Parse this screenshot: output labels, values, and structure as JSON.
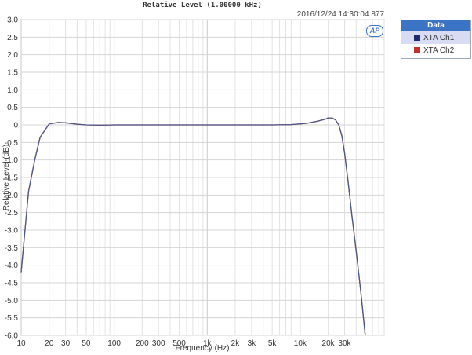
{
  "chart_data": {
    "type": "line",
    "title": "Relative Level (1.00000 kHz)",
    "timestamp": "2016/12/24 14:30:04.877",
    "xlabel": "Frequency (Hz)",
    "ylabel": "Relative Level (dB)",
    "x_scale": "log",
    "xlim": [
      10,
      80000
    ],
    "ylim": [
      -6.0,
      3.0
    ],
    "grid": true,
    "legend_position": "right",
    "x_tick_labels": [
      "10",
      "20",
      "30",
      "50",
      "100",
      "200",
      "300",
      "500",
      "1k",
      "2k",
      "3k",
      "5k",
      "10k",
      "20k",
      "30k"
    ],
    "x_tick_values": [
      10,
      20,
      30,
      50,
      100,
      200,
      300,
      500,
      1000,
      2000,
      3000,
      5000,
      10000,
      20000,
      30000
    ],
    "y_ticks": [
      3.0,
      2.5,
      2.0,
      1.5,
      1.0,
      0.5,
      0,
      -0.5,
      -1.0,
      -1.5,
      -2.0,
      -2.5,
      -3.0,
      -3.5,
      -4.0,
      -4.5,
      -5.0,
      -5.5,
      -6.0
    ],
    "y_tick_labels": [
      "3.0",
      "2.5",
      "2.0",
      "1.5",
      "1.0",
      "0.5",
      "0",
      "-0.5",
      "-1.0",
      "-1.5",
      "-2.0",
      "-2.5",
      "-3.0",
      "-3.5",
      "-4.0",
      "-4.5",
      "-5.0",
      "-5.5",
      "-6.0"
    ],
    "legend_title": "Data",
    "series": [
      {
        "name": "XTA Ch1",
        "color": "#1f2a6e",
        "x": [
          10,
          11,
          12,
          14,
          16,
          18,
          20,
          25,
          30,
          40,
          50,
          70,
          100,
          200,
          500,
          1000,
          2000,
          5000,
          8000,
          10000,
          12000,
          15000,
          18000,
          20000,
          22000,
          24000,
          26000,
          28000,
          30000,
          33000,
          36000,
          40000,
          45000,
          50000
        ],
        "values": [
          -4.2,
          -3.0,
          -1.9,
          -1.0,
          -0.35,
          -0.15,
          0.03,
          0.07,
          0.06,
          0.02,
          0.0,
          -0.01,
          0.0,
          0.0,
          0.0,
          0.0,
          0.0,
          0.0,
          0.01,
          0.03,
          0.05,
          0.1,
          0.15,
          0.2,
          0.2,
          0.14,
          0.0,
          -0.3,
          -0.8,
          -1.7,
          -2.6,
          -3.6,
          -4.8,
          -6.0
        ]
      },
      {
        "name": "XTA Ch2",
        "color": "#c0322b",
        "x": [
          10,
          11,
          12,
          14,
          16,
          18,
          20,
          25,
          30,
          40,
          50,
          70,
          100,
          200,
          500,
          1000,
          2000,
          5000,
          8000,
          10000,
          12000,
          15000,
          18000,
          20000,
          22000,
          24000,
          26000,
          28000,
          30000,
          33000,
          36000,
          40000,
          45000,
          50000
        ],
        "values": [
          -4.2,
          -3.0,
          -1.9,
          -1.0,
          -0.35,
          -0.15,
          0.03,
          0.07,
          0.06,
          0.02,
          0.0,
          -0.01,
          0.0,
          0.0,
          0.0,
          0.0,
          0.0,
          0.0,
          0.01,
          0.03,
          0.05,
          0.1,
          0.15,
          0.2,
          0.2,
          0.14,
          0.0,
          -0.3,
          -0.8,
          -1.7,
          -2.6,
          -3.6,
          -4.8,
          -6.0
        ]
      }
    ]
  }
}
